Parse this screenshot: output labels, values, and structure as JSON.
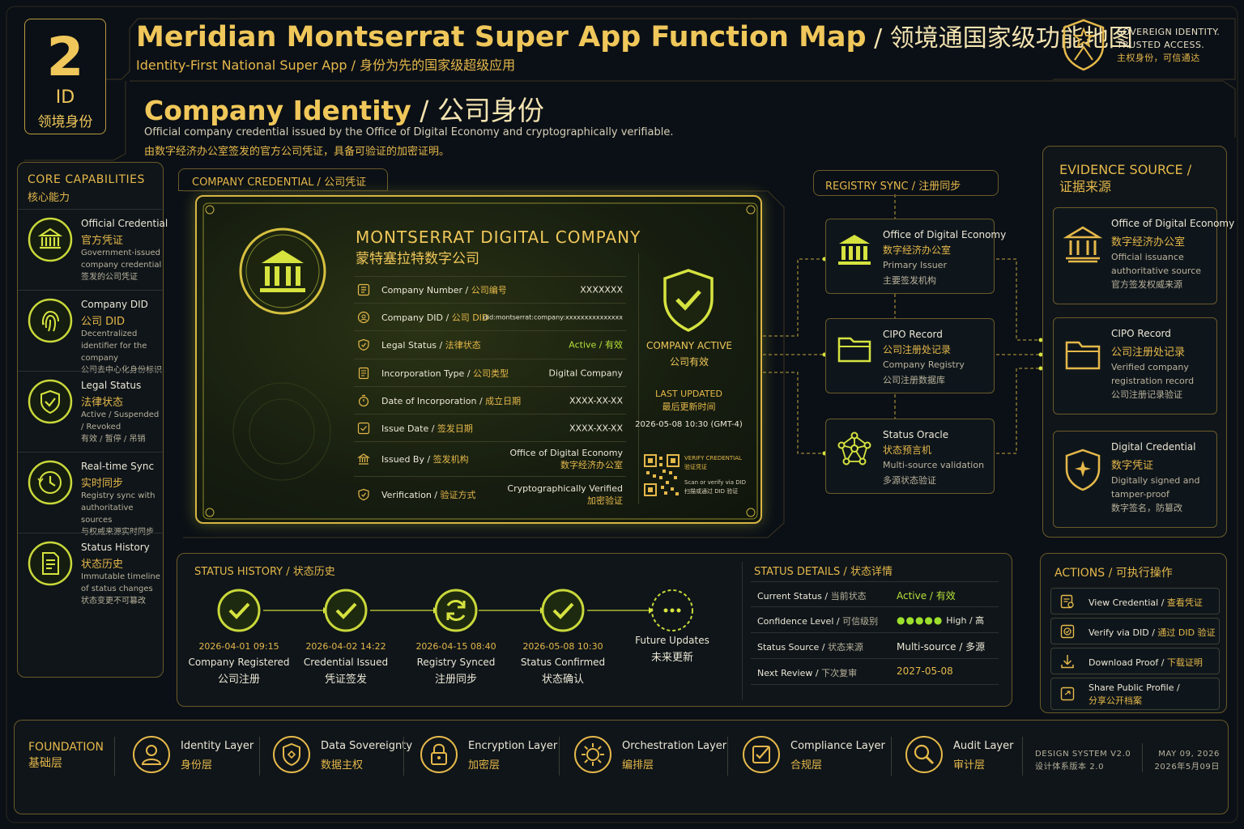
{
  "header": {
    "badge_num": "2",
    "badge_id": "ID",
    "badge_cn": "领境身份",
    "title_en": "Meridian Montserrat Super App Function Map",
    "title_sep": " / ",
    "title_cn": "领境通国家级功能地图",
    "subtitle": "Identity-First National Super App / 身份为先的国家级超级应用",
    "sov_line1": "SOVEREIGN IDENTITY.",
    "sov_line2": "TRUSTED ACCESS.",
    "sov_cn": "主权身份，可信通达"
  },
  "page": {
    "title_en": "Company Identity",
    "title_sep": " / ",
    "title_cn": "公司身份",
    "desc_en": "Official company credential issued by the Office of Digital Economy and cryptographically verifiable.",
    "desc_cn": "由数字经济办公室签发的官方公司凭证，具备可验证的加密证明。"
  },
  "capabilities": {
    "heading": "CORE CAPABILITIES",
    "heading_cn": "核心能力",
    "items": [
      {
        "title": "Official Credential",
        "title_cn": "官方凭证",
        "desc": "Government-issued company credential",
        "desc_cn": "签发的公司凭证",
        "icon": "bank-icon"
      },
      {
        "title": "Company DID",
        "title_cn": "公司 DID",
        "desc": "Decentralized identifier for the company",
        "desc_cn": "公司去中心化身份标识",
        "icon": "fingerprint-icon"
      },
      {
        "title": "Legal Status",
        "title_cn": "法律状态",
        "desc": "Active / Suspended / Revoked",
        "desc_cn": "有效 / 暂停 / 吊销",
        "icon": "shield-check-icon"
      },
      {
        "title": "Real-time Sync",
        "title_cn": "实时同步",
        "desc": "Registry sync with authoritative sources",
        "desc_cn": "与权威来源实时同步",
        "icon": "clock-icon"
      },
      {
        "title": "Status History",
        "title_cn": "状态历史",
        "desc": "Immutable timeline of status changes",
        "desc_cn": "状态变更不可篡改",
        "icon": "document-icon"
      }
    ]
  },
  "credential": {
    "tab": "COMPANY CREDENTIAL",
    "tab_cn": "公司凭证",
    "name": "MONTSERRAT DIGITAL COMPANY",
    "name_cn": "蒙特塞拉特数字公司",
    "rows": [
      {
        "label": "Company Number",
        "label_cn": "公司编号",
        "value": "XXXXXXX",
        "value_cn": ""
      },
      {
        "label": "Company DID",
        "label_cn": "公司 DID",
        "value": "did:montserrat:company:xxxxxxxxxxxxxxx",
        "value_cn": ""
      },
      {
        "label": "Legal Status",
        "label_cn": "法律状态",
        "value": "Active / 有效",
        "value_cn": ""
      },
      {
        "label": "Incorporation Type",
        "label_cn": "公司类型",
        "value": "Digital Company",
        "value_cn": ""
      },
      {
        "label": "Date of Incorporation",
        "label_cn": "成立日期",
        "value": "XXXX-XX-XX",
        "value_cn": ""
      },
      {
        "label": "Issue Date",
        "label_cn": "签发日期",
        "value": "XXXX-XX-XX",
        "value_cn": ""
      },
      {
        "label": "Issued By",
        "label_cn": "签发机构",
        "value": "Office of Digital Economy",
        "value_cn": "数字经济办公室"
      },
      {
        "label": "Verification",
        "label_cn": "验证方式",
        "value": "Cryptographically Verified",
        "value_cn": "加密验证"
      }
    ],
    "status": "COMPANY ACTIVE",
    "status_cn": "公司有效",
    "last_updated": "LAST UPDATED",
    "last_updated_cn": "最后更新时间",
    "last_updated_value": "2026-05-08 10:30 (GMT-4)",
    "qr_title": "VERIFY CREDENTIAL",
    "qr_title_cn": "验证凭证",
    "qr_hint": "Scan or verify via DID",
    "qr_hint_cn": "扫描或通过 DID 验证"
  },
  "registry": {
    "tab": "REGISTRY SYNC",
    "tab_cn": "注册同步",
    "items": [
      {
        "title": "Office of Digital Economy",
        "title_cn": "数字经济办公室",
        "desc": "Primary Issuer",
        "desc_cn": "主要签发机构"
      },
      {
        "title": "CIPO Record",
        "title_cn": "公司注册处记录",
        "desc": "Company Registry",
        "desc_cn": "公司注册数据库"
      },
      {
        "title": "Status Oracle",
        "title_cn": "状态预言机",
        "desc": "Multi-source validation",
        "desc_cn": "多源状态验证"
      }
    ]
  },
  "evidence": {
    "heading": "EVIDENCE SOURCE /",
    "heading_cn": "证据来源",
    "items": [
      {
        "title": "Office of Digital Economy",
        "title_cn": "数字经济办公室",
        "desc": "Official issuance authoritative source",
        "desc_cn": "官方签发权威来源"
      },
      {
        "title": "CIPO Record",
        "title_cn": "公司注册处记录",
        "desc": "Verified company registration record",
        "desc_cn": "公司注册记录验证"
      },
      {
        "title": "Digital Credential",
        "title_cn": "数字凭证",
        "desc": "Digitally signed and tamper-proof",
        "desc_cn": "数字签名，防篡改"
      }
    ]
  },
  "history": {
    "heading": "STATUS HISTORY",
    "heading_cn": "状态历史",
    "steps": [
      {
        "date": "2026-04-01 09:15",
        "label": "Company Registered",
        "label_cn": "公司注册",
        "icon": "check-icon"
      },
      {
        "date": "2026-04-02 14:22",
        "label": "Credential Issued",
        "label_cn": "凭证签发",
        "icon": "check-icon"
      },
      {
        "date": "2026-04-15 08:40",
        "label": "Registry Synced",
        "label_cn": "注册同步",
        "icon": "sync-icon"
      },
      {
        "date": "2026-05-08 10:30",
        "label": "Status Confirmed",
        "label_cn": "状态确认",
        "icon": "check-icon"
      },
      {
        "date": "",
        "label": "Future Updates",
        "label_cn": "未来更新",
        "icon": "more-icon"
      }
    ]
  },
  "details": {
    "heading": "STATUS DETAILS",
    "heading_cn": "状态详情",
    "rows": [
      {
        "key": "Current Status",
        "key_cn": "当前状态",
        "value": "Active / 有效",
        "color": "#b9e23a"
      },
      {
        "key": "Confidence Level",
        "key_cn": "可信级别",
        "value": "High / 高",
        "dots": "●●●●●",
        "color": "#ece7d6"
      },
      {
        "key": "Status Source",
        "key_cn": "状态来源",
        "value": "Multi-source / 多源",
        "color": "#ece7d6"
      },
      {
        "key": "Next Review",
        "key_cn": "下次复审",
        "value": "2027-05-08",
        "color": "#e5b84a"
      }
    ]
  },
  "actions": {
    "heading": "ACTIONS",
    "heading_cn": "可执行操作",
    "items": [
      {
        "label": "View Credential",
        "label_cn": "查看凭证"
      },
      {
        "label": "Verify via DID",
        "label_cn": "通过 DID 验证"
      },
      {
        "label": "Download Proof",
        "label_cn": "下载证明"
      },
      {
        "label": "Share Public Profile",
        "label_cn": "分享公开档案"
      }
    ]
  },
  "foundation": {
    "heading": "FOUNDATION",
    "heading_cn": "基础层",
    "items": [
      {
        "label": "Identity Layer",
        "label_cn": "身份层"
      },
      {
        "label": "Data Sovereignty",
        "label_cn": "数据主权"
      },
      {
        "label": "Encryption Layer",
        "label_cn": "加密层"
      },
      {
        "label": "Orchestration Layer",
        "label_cn": "编排层"
      },
      {
        "label": "Compliance Layer",
        "label_cn": "合规层"
      },
      {
        "label": "Audit Layer",
        "label_cn": "审计层"
      }
    ],
    "design_system": "DESIGN SYSTEM V2.0",
    "design_system_cn": "设计体系版本 2.0",
    "date": "MAY 09, 2026",
    "date_cn": "2026年5月09日"
  }
}
